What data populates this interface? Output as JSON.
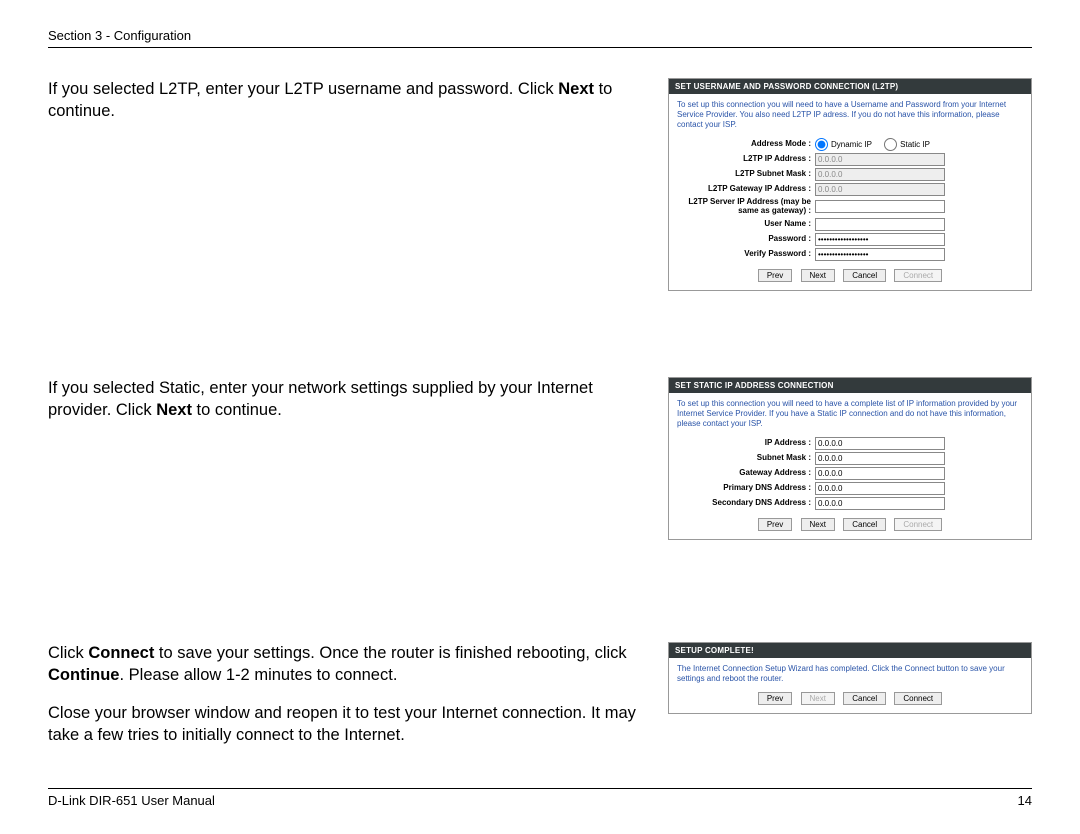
{
  "header": "Section 3 - Configuration",
  "footer_left": "D-Link DIR-651 User Manual",
  "footer_right": "14",
  "block1": {
    "text_parts": {
      "t1": "If you selected L2TP, enter your L2TP username and password. Click ",
      "bold": "Next",
      "t2": " to continue."
    },
    "panel_title": "SET USERNAME AND PASSWORD CONNECTION (L2TP)",
    "panel_desc": "To set up this connection you will need to have a Username and Password from your Internet Service Provider. You also need L2TP IP adress. If you do not have this information, please contact your ISP.",
    "address_mode_label": "Address Mode  :",
    "radio_dynamic": "Dynamic IP",
    "radio_static": "Static IP",
    "fields": {
      "ip_label": "L2TP IP Address  :",
      "ip_val": "0.0.0.0",
      "subnet_label": "L2TP Subnet Mask  :",
      "subnet_val": "0.0.0.0",
      "gw_label": "L2TP Gateway IP Address  :",
      "gw_val": "0.0.0.0",
      "server_label": "L2TP Server IP Address (may be same as gateway)  :",
      "server_val": "",
      "user_label": "User Name  :",
      "user_val": "",
      "pw_label": "Password  :",
      "pw_val": "••••••••••••••••••",
      "vpw_label": "Verify Password  :",
      "vpw_val": "••••••••••••••••••"
    },
    "buttons": {
      "prev": "Prev",
      "next": "Next",
      "cancel": "Cancel",
      "connect": "Connect"
    }
  },
  "block2": {
    "text_parts": {
      "t1": "If you selected Static, enter your network settings supplied by your Internet provider. Click ",
      "bold": "Next",
      "t2": " to continue."
    },
    "panel_title": "SET STATIC IP ADDRESS CONNECTION",
    "panel_desc": "To set up this connection you will need to have a complete list of IP information provided by your Internet Service Provider. If you have a Static IP connection and do not have this information, please contact your ISP.",
    "fields": {
      "ip_label": "IP Address  :",
      "ip_val": "0.0.0.0",
      "subnet_label": "Subnet Mask  :",
      "subnet_val": "0.0.0.0",
      "gw_label": "Gateway Address  :",
      "gw_val": "0.0.0.0",
      "dns1_label": "Primary DNS Address  :",
      "dns1_val": "0.0.0.0",
      "dns2_label": "Secondary DNS Address :",
      "dns2_val": "0.0.0.0"
    },
    "buttons": {
      "prev": "Prev",
      "next": "Next",
      "cancel": "Cancel",
      "connect": "Connect"
    }
  },
  "block3": {
    "para1": {
      "t1": "Click ",
      "b1": "Connect",
      "t2": " to save your settings. Once the router is finished rebooting, click ",
      "b2": "Continue",
      "t3": ". Please allow 1-2 minutes to connect."
    },
    "para2": "Close your browser window and reopen it to test your Internet connection. It may take a few tries to initially connect to the Internet.",
    "panel_title": "SETUP COMPLETE!",
    "panel_desc": "The Internet Connection Setup Wizard has completed. Click the Connect button to save your settings and reboot the router.",
    "buttons": {
      "prev": "Prev",
      "next": "Next",
      "cancel": "Cancel",
      "connect": "Connect"
    }
  }
}
